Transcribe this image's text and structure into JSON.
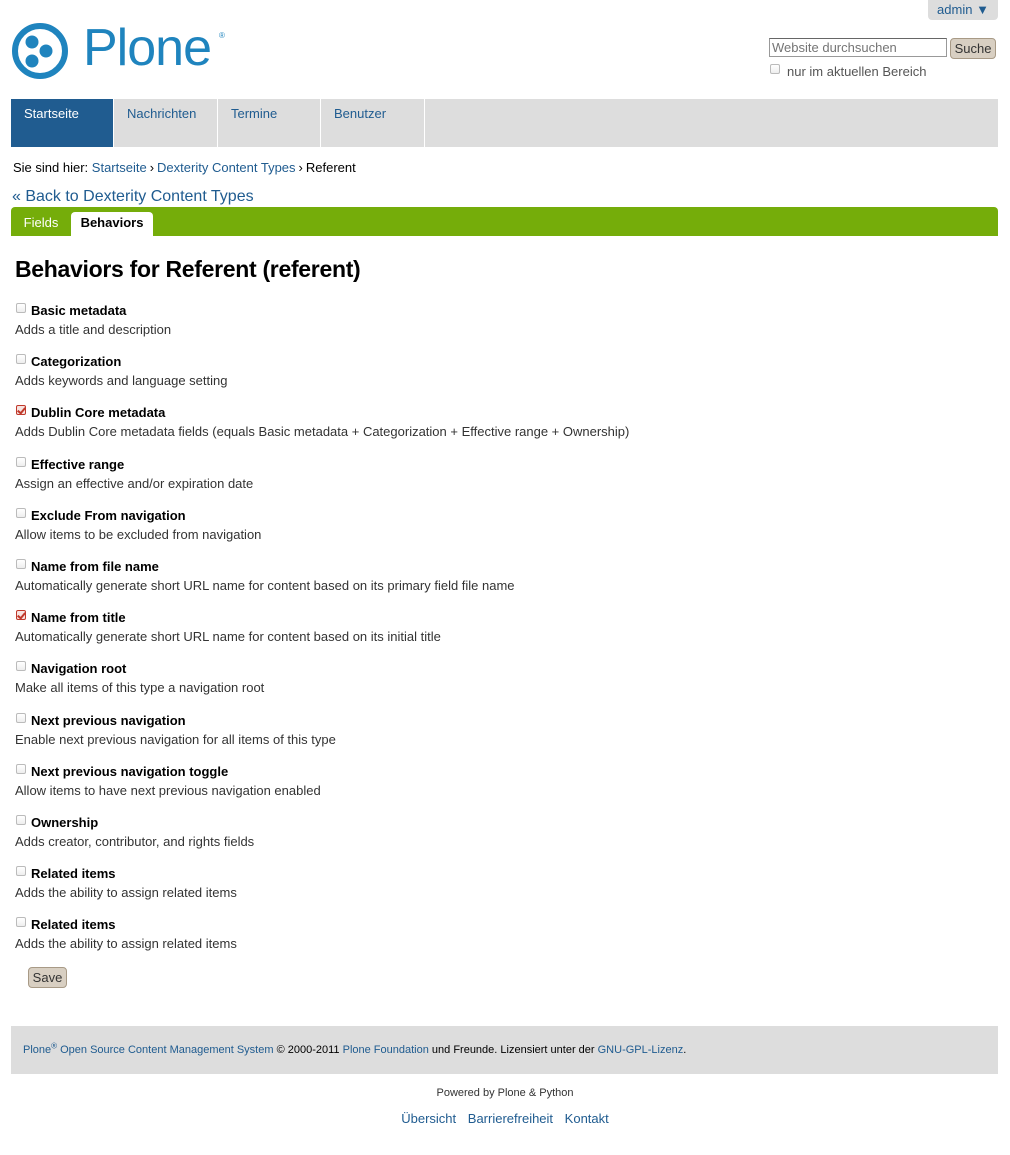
{
  "user_menu": {
    "label": "admin ▼"
  },
  "logo": {
    "text": "Plone",
    "reg_mark": "®",
    "icon": "plone-logo-icon"
  },
  "search": {
    "placeholder": "Website durchsuchen",
    "button_label": "Suche",
    "scope_label": "nur im aktuellen Bereich",
    "scope_checked": false
  },
  "global_nav": [
    {
      "label": "Startseite",
      "active": true
    },
    {
      "label": "Nachrichten",
      "active": false
    },
    {
      "label": "Termine",
      "active": false
    },
    {
      "label": "Benutzer",
      "active": false
    }
  ],
  "breadcrumbs": {
    "prefix": "Sie sind hier:",
    "items": [
      "Startseite",
      "Dexterity Content Types"
    ],
    "current": "Referent",
    "separator": "›"
  },
  "back_link": "« Back to Dexterity Content Types",
  "edit_tabs": {
    "fields": "Fields",
    "behaviors": "Behaviors"
  },
  "page_title": "Behaviors for Referent (referent)",
  "behaviors": [
    {
      "title": "Basic metadata",
      "description": "Adds a title and description",
      "checked": false
    },
    {
      "title": "Categorization",
      "description": "Adds keywords and language setting",
      "checked": false
    },
    {
      "title": "Dublin Core metadata",
      "description": "Adds Dublin Core metadata fields (equals Basic metadata + Categorization + Effective range + Ownership)",
      "checked": true
    },
    {
      "title": "Effective range",
      "description": "Assign an effective and/or expiration date",
      "checked": false
    },
    {
      "title": "Exclude From navigation",
      "description": "Allow items to be excluded from navigation",
      "checked": false
    },
    {
      "title": "Name from file name",
      "description": "Automatically generate short URL name for content based on its primary field file name",
      "checked": false
    },
    {
      "title": "Name from title",
      "description": "Automatically generate short URL name for content based on its initial title",
      "checked": true
    },
    {
      "title": "Navigation root",
      "description": "Make all items of this type a navigation root",
      "checked": false
    },
    {
      "title": "Next previous navigation",
      "description": "Enable next previous navigation for all items of this type",
      "checked": false
    },
    {
      "title": "Next previous navigation toggle",
      "description": "Allow items to have next previous navigation enabled",
      "checked": false
    },
    {
      "title": "Ownership",
      "description": "Adds creator, contributor, and rights fields",
      "checked": false
    },
    {
      "title": "Related items",
      "description": "Adds the ability to assign related items",
      "checked": false
    },
    {
      "title": "Related items",
      "description": "Adds the ability to assign related items",
      "checked": false
    }
  ],
  "save_label": "Save",
  "footer": {
    "plone": "Plone",
    "reg": "®",
    "cms": "Open Source Content Management System",
    "copyright": "©",
    "years": "2000-2011",
    "foundation": "Plone Foundation",
    "text1": "und Freunde. Lizensiert unter der",
    "license": "GNU-GPL-Lizenz",
    "period": "."
  },
  "powered_by": "Powered by Plone & Python",
  "site_actions": [
    "Übersicht",
    "Barrierefreiheit",
    "Kontakt"
  ],
  "colors": {
    "link": "#205c90",
    "nav_active": "#205c90",
    "editbar_green": "#75ad0a",
    "logo_blue": "#1f84be",
    "button_bg": "#d8cfc2"
  }
}
